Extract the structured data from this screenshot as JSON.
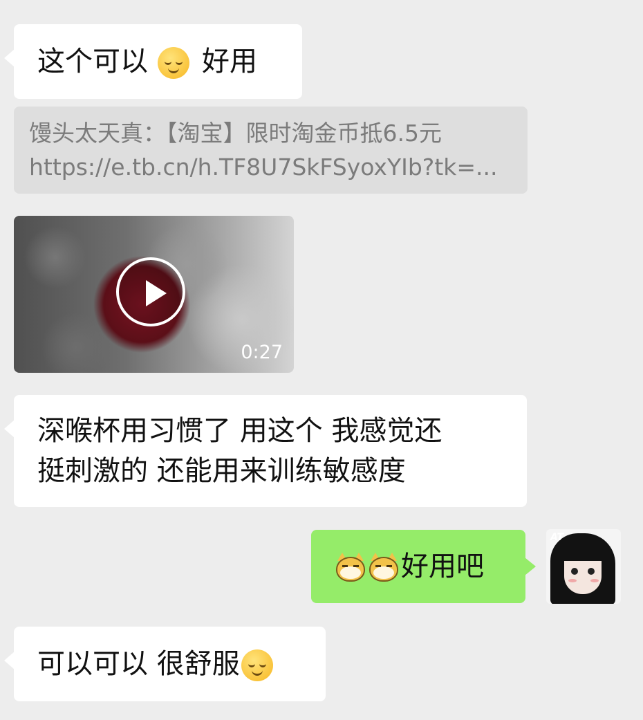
{
  "messages": [
    {
      "side": "left",
      "type": "text",
      "text": "这个可以",
      "emoji": "relieved-face-emoji",
      "text_after": "好用"
    },
    {
      "side": "left",
      "type": "link",
      "title": "馒头太天真：【淘宝】限时淘金币抵6.5元",
      "url": "https://e.tb.cn/h.TF8U7SkFSyoxYIb?tk=..."
    },
    {
      "side": "left",
      "type": "video",
      "duration": "0:27"
    },
    {
      "side": "left",
      "type": "text",
      "line1": "深喉杯用习惯了 用这个 我感觉还",
      "line2": "挺刺激的 还能用来训练敏感度"
    },
    {
      "side": "right",
      "type": "text",
      "emoji": "doge-emoji",
      "text": "好用吧"
    },
    {
      "side": "left",
      "type": "text",
      "text": "可以可以 很舒服",
      "emoji": "relieved-face-emoji"
    }
  ],
  "avatar": {
    "mark": "AT"
  },
  "colors": {
    "background": "#ededed",
    "incoming_bubble": "#ffffff",
    "outgoing_bubble": "#95ec69",
    "link_card": "#dedede"
  }
}
